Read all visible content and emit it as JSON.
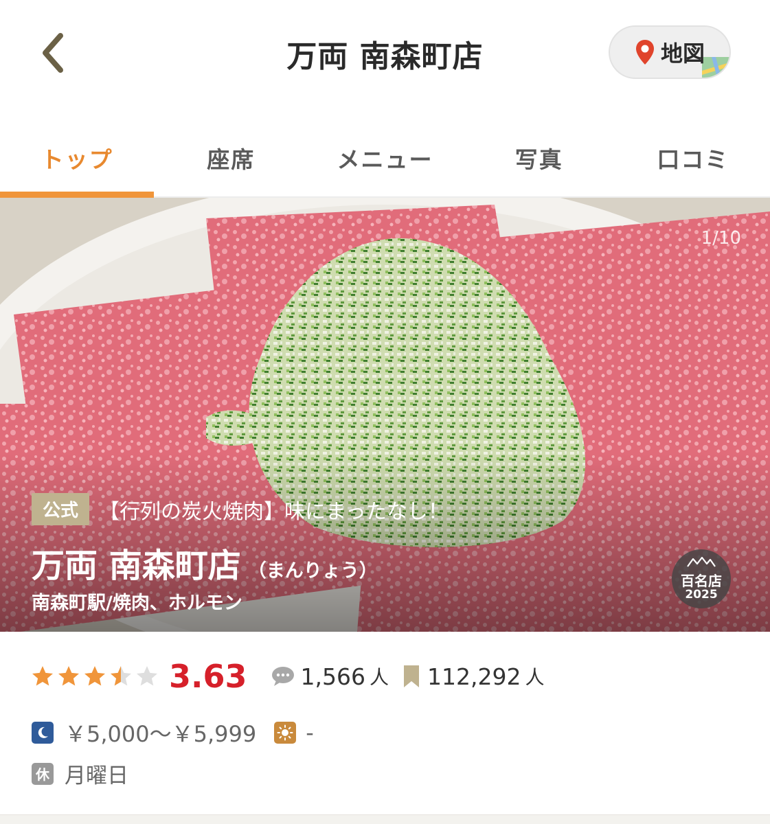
{
  "header": {
    "title": "万両 南森町店",
    "map_label": "地図"
  },
  "tabs": [
    {
      "label": "トップ",
      "active": true
    },
    {
      "label": "座席",
      "active": false
    },
    {
      "label": "メニュー",
      "active": false
    },
    {
      "label": "写真",
      "active": false
    },
    {
      "label": "口コミ",
      "active": false
    }
  ],
  "hero": {
    "counter": "1/10",
    "badge": "公式",
    "tagline": "【行列の炭火焼肉】味にまったなし！",
    "name": "万両 南森町店",
    "reading": "（まんりょう）",
    "genre": "南森町駅/焼肉、ホルモン",
    "award_label": "百名店",
    "award_year": "2025"
  },
  "rating": {
    "stars": 3.5,
    "score": "3.63",
    "reviews": "1,566",
    "bookmarks": "112,292",
    "unit": "人"
  },
  "price": {
    "dinner": "￥5,000～￥5,999",
    "lunch": "-"
  },
  "holiday": {
    "badge": "休",
    "text": "月曜日"
  },
  "colors": {
    "accent": "#f0953a",
    "score": "#d6202a",
    "star": "#f0953a",
    "dinner_icon": "#2f5b9a",
    "lunch_icon": "#c98a3c"
  }
}
